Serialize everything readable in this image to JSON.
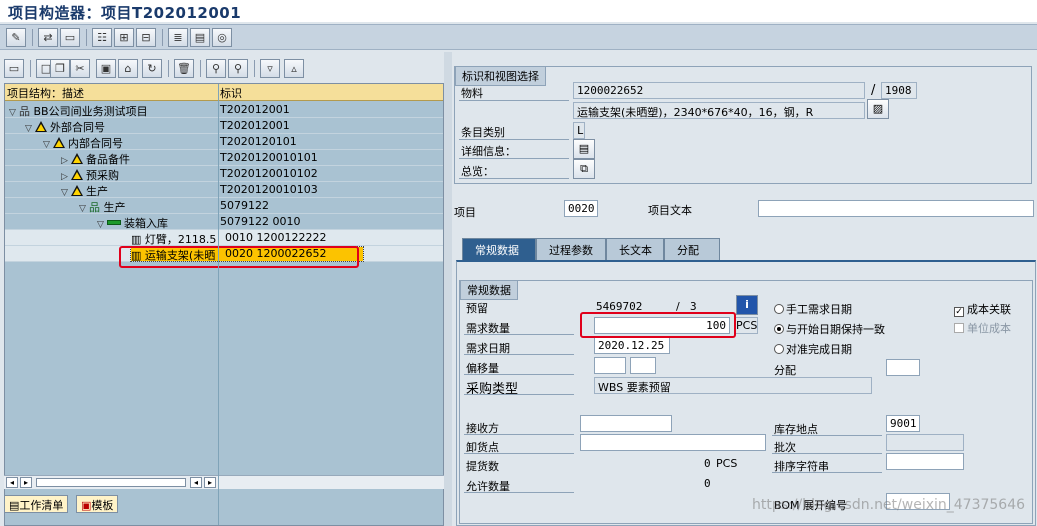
{
  "window": {
    "title": "项目构造器：项目T202012001"
  },
  "toolbar1": {
    "icons": [
      "edit-icon",
      "switch-icon",
      "blank-icon",
      "hierarchy-icon",
      "structure-icon",
      "network-icon",
      "list-icon",
      "worklist-icon",
      "settings-icon"
    ]
  },
  "toolbar2": {
    "icons": [
      "open-folder-icon",
      "new-icon",
      "copy-icon",
      "cut-icon",
      "paste-icon",
      "undo-icon",
      "delete-icon",
      "find-icon",
      "find-next-icon",
      "expand-icon",
      "collapse-icon"
    ]
  },
  "tree": {
    "col_desc": "项目结构：描述",
    "col_id": "标识",
    "rows": [
      {
        "desc": "BB公司间业务测试项目",
        "id": "T202012001"
      },
      {
        "desc": "外部合同号",
        "id": "T202012001"
      },
      {
        "desc": "内部合同号",
        "id": "T2020120101"
      },
      {
        "desc": "备品备件",
        "id": "T2020120010101"
      },
      {
        "desc": "预采购",
        "id": "T2020120010102"
      },
      {
        "desc": "生产",
        "id": "T2020120010103"
      },
      {
        "desc": "生产",
        "id": "5079122"
      },
      {
        "desc": "装箱入库",
        "id": "5079122 0010"
      },
      {
        "desc": "灯臂，2118.5",
        "id": "0010 1200122222"
      },
      {
        "desc": "运输支架(未晒",
        "id": "0020 1200022652"
      }
    ]
  },
  "bottom_tabs": {
    "worklist": "工作清单",
    "template": "模板"
  },
  "ident": {
    "group_title": "标识和视图选择",
    "material_label": "物料",
    "material_value": "1200022652",
    "slash": "/",
    "plant_value": "1908",
    "material_desc": "运输支架(未晒塑)，2340*676*40，16，钢，R",
    "item_category_label": "条目类别",
    "item_category_value": "L",
    "detail_label": "详细信息：",
    "overview_label": "总览："
  },
  "item": {
    "item_label": "项目",
    "item_value": "0020",
    "item_text_label": "项目文本",
    "item_text_value": ""
  },
  "tabs": [
    "常规数据",
    "过程参数",
    "长文本",
    "分配"
  ],
  "general": {
    "group_title": "常规数据",
    "reservation_label": "预留",
    "reservation_value": "5469702",
    "reservation_sep": "/",
    "reservation_item": "3",
    "req_qty_label": "需求数量",
    "req_qty_value": "100",
    "req_qty_unit": "PCS",
    "req_date_label": "需求日期",
    "req_date_value": "2020.12.25",
    "offset_label": "偏移量",
    "purchase_type_label": "采购类型",
    "purchase_type_value": "WBS 要素预留",
    "radio_manual": "手工需求日期",
    "radio_start": "与开始日期保持一致",
    "radio_finish": "对准完成日期",
    "cost_relevant": "成本关联",
    "unit_cost": "单位成本",
    "assignment_label": "分配",
    "recipient_label": "接收方",
    "unloading_label": "卸货点",
    "withdrawn_label": "提货数",
    "withdrawn_value": "0",
    "withdrawn_unit": "PCS",
    "allowed_label": "允许数量",
    "allowed_value": "0",
    "storage_label": "库存地点",
    "storage_value": "9001",
    "batch_label": "批次",
    "sort_label": "排序字符串",
    "bom_label": "BOM 展开编号"
  },
  "watermark": "https://blog.csdn.net/weixin_47375646"
}
